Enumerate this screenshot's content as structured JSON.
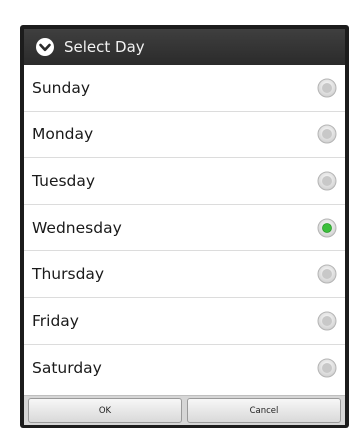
{
  "dialog": {
    "title": "Select Day",
    "title_icon": "chevron-down-circle-icon",
    "options": [
      {
        "label": "Sunday",
        "selected": false
      },
      {
        "label": "Monday",
        "selected": false
      },
      {
        "label": "Tuesday",
        "selected": false
      },
      {
        "label": "Wednesday",
        "selected": true
      },
      {
        "label": "Thursday",
        "selected": false
      },
      {
        "label": "Friday",
        "selected": false
      },
      {
        "label": "Saturday",
        "selected": false
      }
    ],
    "ok_label": "OK",
    "cancel_label": "Cancel"
  },
  "colors": {
    "selected_radio": "#3bbf3b",
    "unselected_radio": "#c8c8c8"
  }
}
